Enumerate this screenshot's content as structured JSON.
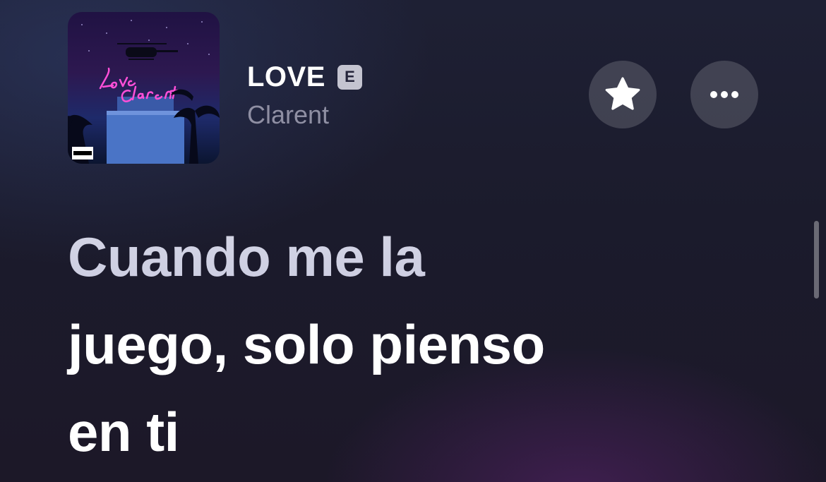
{
  "track": {
    "title": "LOVE",
    "explicit_label": "E",
    "artist": "Clarent"
  },
  "album_art": {
    "logo_text": "Love Clarent",
    "advisory_text": "PARENTAL ADVISORY EXPLICIT CONTENT",
    "neon_color": "#ff4fd8"
  },
  "actions": {
    "favorite_icon": "star-icon",
    "more_icon": "ellipsis-icon"
  },
  "lyrics": {
    "lines": [
      "Cuando me la",
      "juego, solo pienso",
      "en ti"
    ]
  },
  "colors": {
    "title": "#ffffff",
    "artist": "#8f8fa3",
    "button_bg": "rgba(255,255,255,0.16)"
  }
}
